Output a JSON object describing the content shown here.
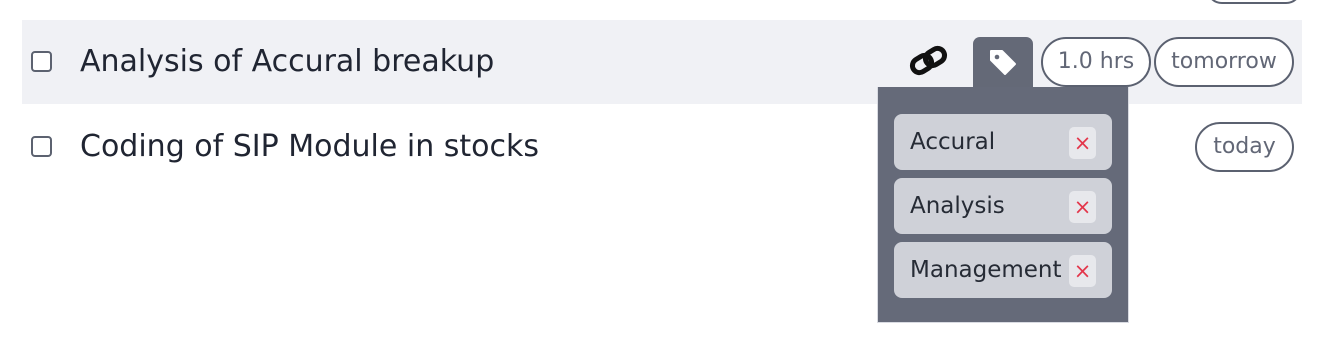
{
  "tasks": [
    {
      "title": "Analysis of Accural breakup",
      "estimate": "1.0 hrs",
      "due": "tomorrow"
    },
    {
      "title": "Coding of SIP Module in stocks",
      "due": "today"
    }
  ],
  "tag_dropdown": {
    "tags": [
      {
        "label": "Accural",
        "remove": "×"
      },
      {
        "label": "Analysis",
        "remove": "×"
      },
      {
        "label": "Management",
        "remove": "×"
      }
    ]
  },
  "icons": {
    "link": "link-icon",
    "tag": "tag-icon",
    "remove": "close-icon"
  },
  "colors": {
    "selected_row_bg": "#f0f1f5",
    "dropdown_bg": "#656a79",
    "chip_bg": "#cfd1d8",
    "remove_x": "#e3364b",
    "pill_border": "#5b6170"
  }
}
